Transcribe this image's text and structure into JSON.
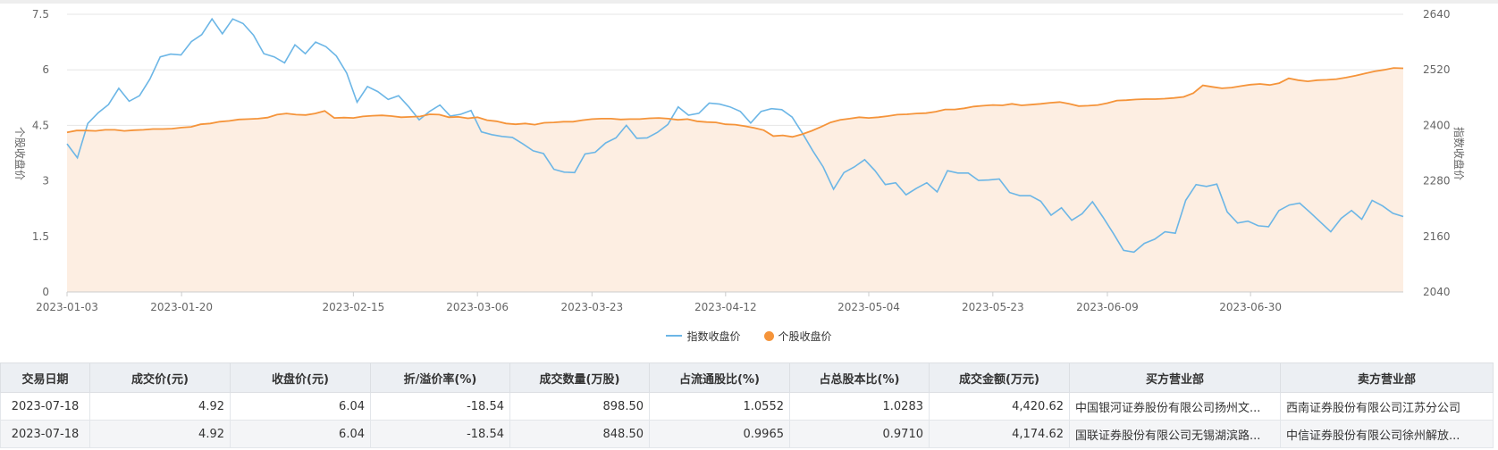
{
  "chart_data": {
    "type": "line",
    "x_ticks": [
      "2023-01-03",
      "2023-01-20",
      "2023-02-15",
      "2023-03-06",
      "2023-03-23",
      "2023-04-12",
      "2023-05-04",
      "2023-05-23",
      "2023-06-09",
      "2023-06-30"
    ],
    "y_left_ticks": [
      "0",
      "1.5",
      "3",
      "4.5",
      "6",
      "7.5"
    ],
    "y_right_ticks": [
      "2040",
      "2160",
      "2280",
      "2400",
      "2520",
      "2640"
    ],
    "ylabel_left": "个股收盘价",
    "ylabel_right": "指数收盘价",
    "ylim_left": [
      0,
      7.5
    ],
    "ylim_right": [
      2040,
      2640
    ],
    "grid": true,
    "legend_position": "bottom-center",
    "colors": {
      "index": "#6cb6e6",
      "stock": "#f5943a",
      "stock_fill": "#fdeee2"
    },
    "series": [
      {
        "name": "指数收盘价",
        "axis": "right",
        "values": [
          2360,
          2330,
          2404,
          2427,
          2445,
          2480,
          2452,
          2464,
          2500,
          2548,
          2554,
          2552,
          2581,
          2596,
          2630,
          2598,
          2630,
          2620,
          2595,
          2555,
          2548,
          2535,
          2574,
          2555,
          2580,
          2570,
          2550,
          2513,
          2450,
          2484,
          2473,
          2456,
          2464,
          2440,
          2412,
          2430,
          2444,
          2420,
          2424,
          2432,
          2386,
          2380,
          2376,
          2374,
          2360,
          2345,
          2339,
          2305,
          2299,
          2298,
          2338,
          2342,
          2362,
          2373,
          2400,
          2372,
          2373,
          2385,
          2402,
          2440,
          2422,
          2426,
          2448,
          2446,
          2440,
          2430,
          2405,
          2430,
          2436,
          2434,
          2418,
          2383,
          2345,
          2310,
          2262,
          2298,
          2310,
          2326,
          2302,
          2272,
          2276,
          2250,
          2264,
          2276,
          2256,
          2302,
          2297,
          2297,
          2281,
          2282,
          2284,
          2255,
          2248,
          2248,
          2236,
          2206,
          2222,
          2195,
          2209,
          2235,
          2202,
          2167,
          2130,
          2126,
          2145,
          2154,
          2170,
          2167,
          2238,
          2272,
          2268,
          2273,
          2213,
          2189,
          2193,
          2183,
          2181,
          2216,
          2228,
          2232,
          2212,
          2191,
          2170,
          2199,
          2216,
          2197,
          2238,
          2226,
          2210,
          2203
        ]
      },
      {
        "name": "个股收盘价",
        "axis": "left",
        "values": [
          4.31,
          4.36,
          4.36,
          4.35,
          4.38,
          4.38,
          4.35,
          4.37,
          4.38,
          4.4,
          4.4,
          4.41,
          4.44,
          4.46,
          4.53,
          4.55,
          4.6,
          4.62,
          4.66,
          4.67,
          4.68,
          4.71,
          4.79,
          4.82,
          4.79,
          4.78,
          4.82,
          4.89,
          4.7,
          4.71,
          4.7,
          4.74,
          4.76,
          4.77,
          4.75,
          4.72,
          4.73,
          4.74,
          4.8,
          4.79,
          4.72,
          4.73,
          4.69,
          4.72,
          4.64,
          4.61,
          4.55,
          4.53,
          4.55,
          4.52,
          4.57,
          4.58,
          4.6,
          4.6,
          4.64,
          4.67,
          4.68,
          4.68,
          4.66,
          4.67,
          4.67,
          4.69,
          4.7,
          4.68,
          4.65,
          4.67,
          4.61,
          4.59,
          4.58,
          4.53,
          4.52,
          4.48,
          4.43,
          4.37,
          4.21,
          4.23,
          4.19,
          4.26,
          4.35,
          4.46,
          4.58,
          4.65,
          4.68,
          4.72,
          4.7,
          4.72,
          4.75,
          4.79,
          4.8,
          4.82,
          4.83,
          4.87,
          4.93,
          4.93,
          4.96,
          5.01,
          5.03,
          5.05,
          5.04,
          5.08,
          5.04,
          5.06,
          5.08,
          5.11,
          5.13,
          5.08,
          5.02,
          5.03,
          5.05,
          5.1,
          5.17,
          5.18,
          5.2,
          5.21,
          5.21,
          5.22,
          5.24,
          5.27,
          5.37,
          5.58,
          5.54,
          5.5,
          5.52,
          5.56,
          5.6,
          5.62,
          5.59,
          5.64,
          5.77,
          5.72,
          5.69,
          5.72,
          5.73,
          5.75,
          5.79,
          5.84,
          5.9,
          5.96,
          6.0,
          6.05,
          6.04
        ]
      }
    ]
  },
  "legend": {
    "index_label": "指数收盘价",
    "stock_label": "个股收盘价"
  },
  "table": {
    "headers": [
      "交易日期",
      "成交价(元)",
      "收盘价(元)",
      "折/溢价率(%)",
      "成交数量(万股)",
      "占流通股比(%)",
      "占总股本比(%)",
      "成交金额(万元)",
      "买方营业部",
      "卖方营业部"
    ],
    "rows": [
      [
        "2023-07-18",
        "4.92",
        "6.04",
        "-18.54",
        "898.50",
        "1.0552",
        "1.0283",
        "4,420.62",
        "中国银河证券股份有限公司扬州文...",
        "西南证券股份有限公司江苏分公司"
      ],
      [
        "2023-07-18",
        "4.92",
        "6.04",
        "-18.54",
        "848.50",
        "0.9965",
        "0.9710",
        "4,174.62",
        "国联证券股份有限公司无锡湖滨路...",
        "中信证券股份有限公司徐州解放..."
      ]
    ]
  }
}
